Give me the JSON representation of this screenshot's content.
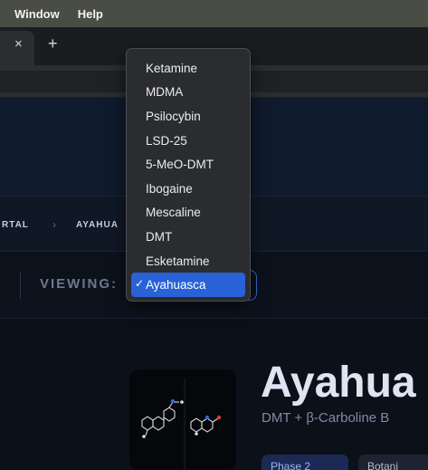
{
  "menubar": {
    "items": [
      "Window",
      "Help"
    ]
  },
  "tabs": {
    "close": "×",
    "new_tab": "+"
  },
  "breadcrumb": {
    "first": "RTAL",
    "separator": "›",
    "second": "AYAHUA"
  },
  "viewing": {
    "label": "VIEWING:"
  },
  "dropdown": {
    "options": [
      "Ketamine",
      "MDMA",
      "Psilocybin",
      "LSD-25",
      "5-MeO-DMT",
      "Ibogaine",
      "Mescaline",
      "DMT",
      "Esketamine",
      "Ayahuasca"
    ],
    "selected": "Ayahuasca",
    "check": "✓"
  },
  "drug": {
    "title": "Ayahua",
    "subtitle": "DMT + β-Carboline B",
    "phase_pill": "Phase 2",
    "other_pill": "Botani"
  },
  "colors": {
    "accent": "#2862d6",
    "focus_ring": "#3c6bd6"
  }
}
